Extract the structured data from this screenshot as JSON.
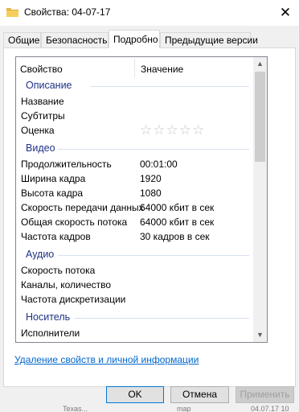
{
  "window": {
    "title": "Свойства: 04-07-17",
    "close_glyph": "✕"
  },
  "tabs": [
    {
      "label": "Общие"
    },
    {
      "label": "Безопасность"
    },
    {
      "label": "Подробно"
    },
    {
      "label": "Предыдущие версии"
    }
  ],
  "list": {
    "col_property": "Свойство",
    "col_value": "Значение",
    "groups": {
      "description": "Описание",
      "video": "Видео",
      "audio": "Аудио",
      "media": "Носитель"
    },
    "rows": {
      "title": {
        "key": "Название",
        "value": ""
      },
      "subtitle": {
        "key": "Субтитры",
        "value": ""
      },
      "rating": {
        "key": "Оценка",
        "stars": "☆☆☆☆☆"
      },
      "duration": {
        "key": "Продолжительность",
        "value": "00:01:00"
      },
      "frame_width": {
        "key": "Ширина кадра",
        "value": "1920"
      },
      "frame_height": {
        "key": "Высота кадра",
        "value": "1080"
      },
      "data_rate": {
        "key": "Скорость передачи данных",
        "value": "64000 кбит в сек"
      },
      "total_bitrate": {
        "key": "Общая скорость потока",
        "value": "64000 кбит в сек"
      },
      "frame_rate": {
        "key": "Частота кадров",
        "value": "30 кадров в сек"
      },
      "audio_bitrate": {
        "key": "Скорость потока",
        "value": ""
      },
      "channels": {
        "key": "Каналы, количество",
        "value": ""
      },
      "sample_rate": {
        "key": "Частота дискретизации",
        "value": ""
      },
      "artists": {
        "key": "Исполнители",
        "value": ""
      }
    }
  },
  "link_remove": "Удаление свойств и личной информации",
  "buttons": {
    "ok": "OK",
    "cancel": "Отмена",
    "apply": "Применить"
  },
  "background_window_text": [
    "Texas...",
    "map",
    "04.07.17 10"
  ]
}
